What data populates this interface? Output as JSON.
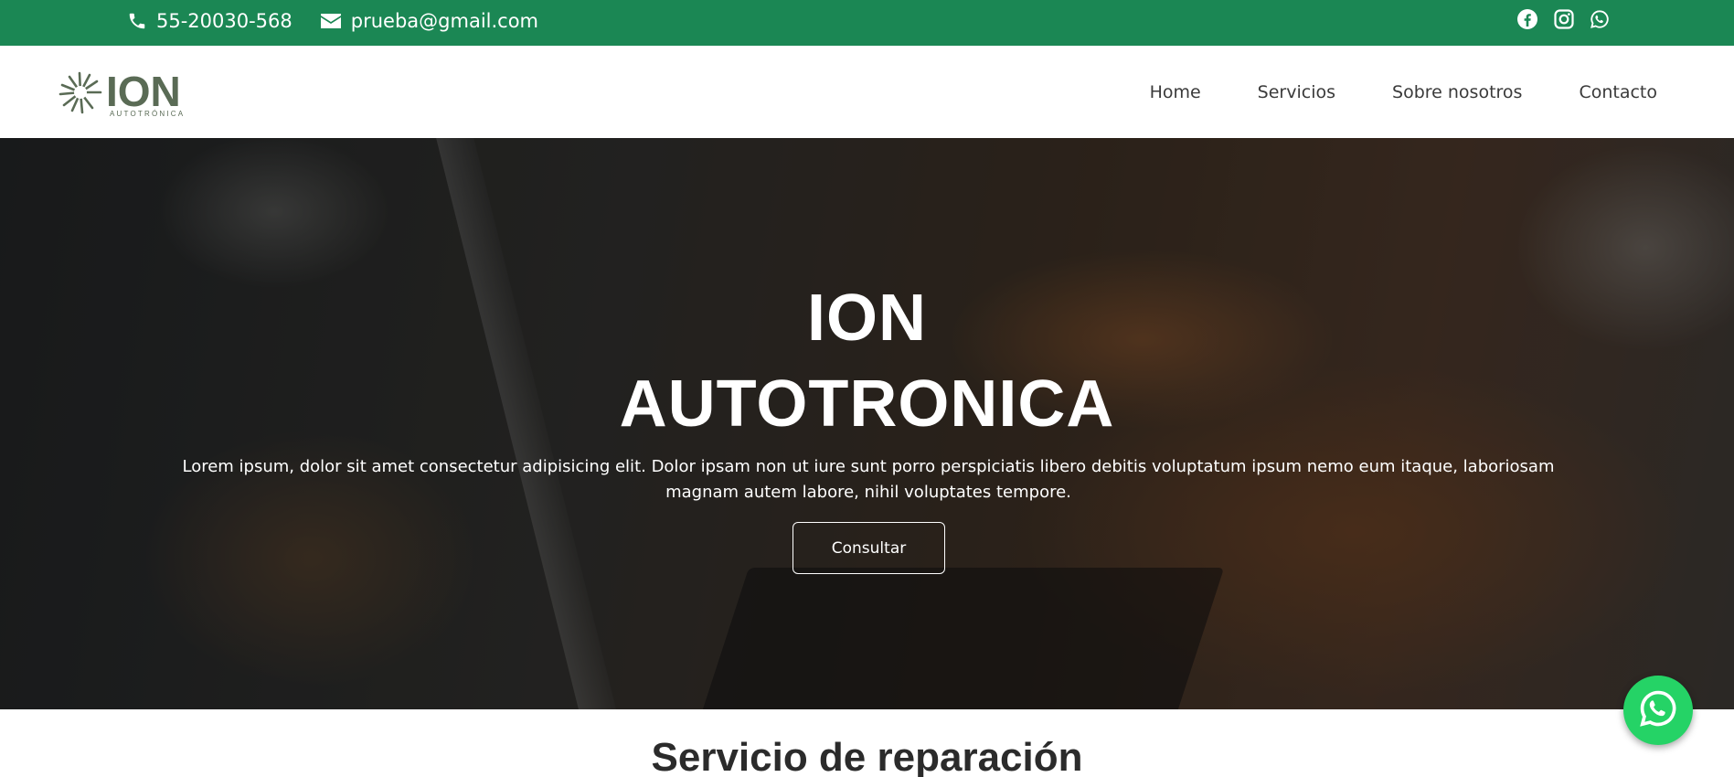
{
  "topbar": {
    "phone": "55-20030-568",
    "email": "prueba@gmail.com",
    "social": [
      "facebook-icon",
      "instagram-icon",
      "whatsapp-icon"
    ],
    "bg_color": "#1b8754"
  },
  "brand": {
    "name": "ION",
    "tagline": "AUTOTRÓNICA",
    "color": "#5a6b55"
  },
  "nav": {
    "items": [
      "Home",
      "Servicios",
      "Sobre nosotros",
      "Contacto"
    ]
  },
  "hero": {
    "title_line1": "ION",
    "title_line2": "AUTOTRONICA",
    "text": "Lorem ipsum, dolor sit amet consectetur adipisicing elit. Dolor ipsam non ut iure sunt porro perspiciatis libero debitis voluptatum ipsum nemo eum itaque, laboriosam magnam autem labore, nihil voluptates tempore.",
    "button": "Consultar"
  },
  "section": {
    "title": "Servicio de reparación"
  },
  "float_button": {
    "icon": "whatsapp-icon",
    "color": "#25d366"
  }
}
